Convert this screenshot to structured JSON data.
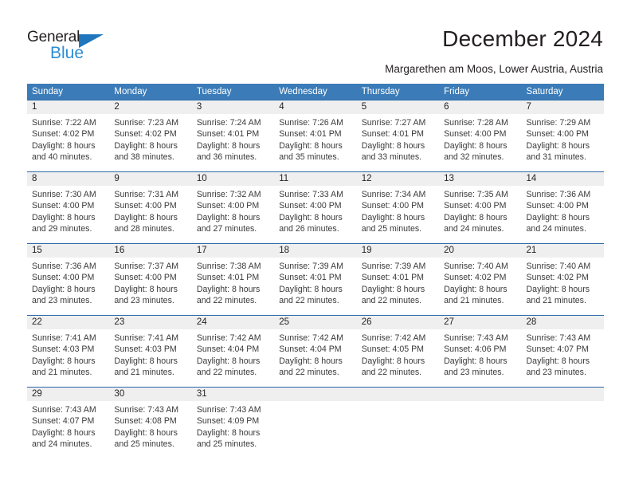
{
  "brand": {
    "name_dark": "General",
    "name_blue": "Blue",
    "accent_color": "#2d8dd3",
    "triangle_color": "#1f76bc"
  },
  "header": {
    "title": "December 2024",
    "subtitle": "Margarethen am Moos, Lower Austria, Austria"
  },
  "calendar": {
    "header_bg": "#3b7cb8",
    "header_text_color": "#ffffff",
    "daynum_band_bg": "#efefef",
    "row_divider_color": "#2c68a8",
    "weekdays": [
      "Sunday",
      "Monday",
      "Tuesday",
      "Wednesday",
      "Thursday",
      "Friday",
      "Saturday"
    ],
    "weeks": [
      [
        {
          "day": "1",
          "sunrise": "Sunrise: 7:22 AM",
          "sunset": "Sunset: 4:02 PM",
          "daylight1": "Daylight: 8 hours",
          "daylight2": "and 40 minutes."
        },
        {
          "day": "2",
          "sunrise": "Sunrise: 7:23 AM",
          "sunset": "Sunset: 4:02 PM",
          "daylight1": "Daylight: 8 hours",
          "daylight2": "and 38 minutes."
        },
        {
          "day": "3",
          "sunrise": "Sunrise: 7:24 AM",
          "sunset": "Sunset: 4:01 PM",
          "daylight1": "Daylight: 8 hours",
          "daylight2": "and 36 minutes."
        },
        {
          "day": "4",
          "sunrise": "Sunrise: 7:26 AM",
          "sunset": "Sunset: 4:01 PM",
          "daylight1": "Daylight: 8 hours",
          "daylight2": "and 35 minutes."
        },
        {
          "day": "5",
          "sunrise": "Sunrise: 7:27 AM",
          "sunset": "Sunset: 4:01 PM",
          "daylight1": "Daylight: 8 hours",
          "daylight2": "and 33 minutes."
        },
        {
          "day": "6",
          "sunrise": "Sunrise: 7:28 AM",
          "sunset": "Sunset: 4:00 PM",
          "daylight1": "Daylight: 8 hours",
          "daylight2": "and 32 minutes."
        },
        {
          "day": "7",
          "sunrise": "Sunrise: 7:29 AM",
          "sunset": "Sunset: 4:00 PM",
          "daylight1": "Daylight: 8 hours",
          "daylight2": "and 31 minutes."
        }
      ],
      [
        {
          "day": "8",
          "sunrise": "Sunrise: 7:30 AM",
          "sunset": "Sunset: 4:00 PM",
          "daylight1": "Daylight: 8 hours",
          "daylight2": "and 29 minutes."
        },
        {
          "day": "9",
          "sunrise": "Sunrise: 7:31 AM",
          "sunset": "Sunset: 4:00 PM",
          "daylight1": "Daylight: 8 hours",
          "daylight2": "and 28 minutes."
        },
        {
          "day": "10",
          "sunrise": "Sunrise: 7:32 AM",
          "sunset": "Sunset: 4:00 PM",
          "daylight1": "Daylight: 8 hours",
          "daylight2": "and 27 minutes."
        },
        {
          "day": "11",
          "sunrise": "Sunrise: 7:33 AM",
          "sunset": "Sunset: 4:00 PM",
          "daylight1": "Daylight: 8 hours",
          "daylight2": "and 26 minutes."
        },
        {
          "day": "12",
          "sunrise": "Sunrise: 7:34 AM",
          "sunset": "Sunset: 4:00 PM",
          "daylight1": "Daylight: 8 hours",
          "daylight2": "and 25 minutes."
        },
        {
          "day": "13",
          "sunrise": "Sunrise: 7:35 AM",
          "sunset": "Sunset: 4:00 PM",
          "daylight1": "Daylight: 8 hours",
          "daylight2": "and 24 minutes."
        },
        {
          "day": "14",
          "sunrise": "Sunrise: 7:36 AM",
          "sunset": "Sunset: 4:00 PM",
          "daylight1": "Daylight: 8 hours",
          "daylight2": "and 24 minutes."
        }
      ],
      [
        {
          "day": "15",
          "sunrise": "Sunrise: 7:36 AM",
          "sunset": "Sunset: 4:00 PM",
          "daylight1": "Daylight: 8 hours",
          "daylight2": "and 23 minutes."
        },
        {
          "day": "16",
          "sunrise": "Sunrise: 7:37 AM",
          "sunset": "Sunset: 4:00 PM",
          "daylight1": "Daylight: 8 hours",
          "daylight2": "and 23 minutes."
        },
        {
          "day": "17",
          "sunrise": "Sunrise: 7:38 AM",
          "sunset": "Sunset: 4:01 PM",
          "daylight1": "Daylight: 8 hours",
          "daylight2": "and 22 minutes."
        },
        {
          "day": "18",
          "sunrise": "Sunrise: 7:39 AM",
          "sunset": "Sunset: 4:01 PM",
          "daylight1": "Daylight: 8 hours",
          "daylight2": "and 22 minutes."
        },
        {
          "day": "19",
          "sunrise": "Sunrise: 7:39 AM",
          "sunset": "Sunset: 4:01 PM",
          "daylight1": "Daylight: 8 hours",
          "daylight2": "and 22 minutes."
        },
        {
          "day": "20",
          "sunrise": "Sunrise: 7:40 AM",
          "sunset": "Sunset: 4:02 PM",
          "daylight1": "Daylight: 8 hours",
          "daylight2": "and 21 minutes."
        },
        {
          "day": "21",
          "sunrise": "Sunrise: 7:40 AM",
          "sunset": "Sunset: 4:02 PM",
          "daylight1": "Daylight: 8 hours",
          "daylight2": "and 21 minutes."
        }
      ],
      [
        {
          "day": "22",
          "sunrise": "Sunrise: 7:41 AM",
          "sunset": "Sunset: 4:03 PM",
          "daylight1": "Daylight: 8 hours",
          "daylight2": "and 21 minutes."
        },
        {
          "day": "23",
          "sunrise": "Sunrise: 7:41 AM",
          "sunset": "Sunset: 4:03 PM",
          "daylight1": "Daylight: 8 hours",
          "daylight2": "and 21 minutes."
        },
        {
          "day": "24",
          "sunrise": "Sunrise: 7:42 AM",
          "sunset": "Sunset: 4:04 PM",
          "daylight1": "Daylight: 8 hours",
          "daylight2": "and 22 minutes."
        },
        {
          "day": "25",
          "sunrise": "Sunrise: 7:42 AM",
          "sunset": "Sunset: 4:04 PM",
          "daylight1": "Daylight: 8 hours",
          "daylight2": "and 22 minutes."
        },
        {
          "day": "26",
          "sunrise": "Sunrise: 7:42 AM",
          "sunset": "Sunset: 4:05 PM",
          "daylight1": "Daylight: 8 hours",
          "daylight2": "and 22 minutes."
        },
        {
          "day": "27",
          "sunrise": "Sunrise: 7:43 AM",
          "sunset": "Sunset: 4:06 PM",
          "daylight1": "Daylight: 8 hours",
          "daylight2": "and 23 minutes."
        },
        {
          "day": "28",
          "sunrise": "Sunrise: 7:43 AM",
          "sunset": "Sunset: 4:07 PM",
          "daylight1": "Daylight: 8 hours",
          "daylight2": "and 23 minutes."
        }
      ],
      [
        {
          "day": "29",
          "sunrise": "Sunrise: 7:43 AM",
          "sunset": "Sunset: 4:07 PM",
          "daylight1": "Daylight: 8 hours",
          "daylight2": "and 24 minutes."
        },
        {
          "day": "30",
          "sunrise": "Sunrise: 7:43 AM",
          "sunset": "Sunset: 4:08 PM",
          "daylight1": "Daylight: 8 hours",
          "daylight2": "and 25 minutes."
        },
        {
          "day": "31",
          "sunrise": "Sunrise: 7:43 AM",
          "sunset": "Sunset: 4:09 PM",
          "daylight1": "Daylight: 8 hours",
          "daylight2": "and 25 minutes."
        },
        {
          "day": "",
          "sunrise": "",
          "sunset": "",
          "daylight1": "",
          "daylight2": ""
        },
        {
          "day": "",
          "sunrise": "",
          "sunset": "",
          "daylight1": "",
          "daylight2": ""
        },
        {
          "day": "",
          "sunrise": "",
          "sunset": "",
          "daylight1": "",
          "daylight2": ""
        },
        {
          "day": "",
          "sunrise": "",
          "sunset": "",
          "daylight1": "",
          "daylight2": ""
        }
      ]
    ]
  }
}
